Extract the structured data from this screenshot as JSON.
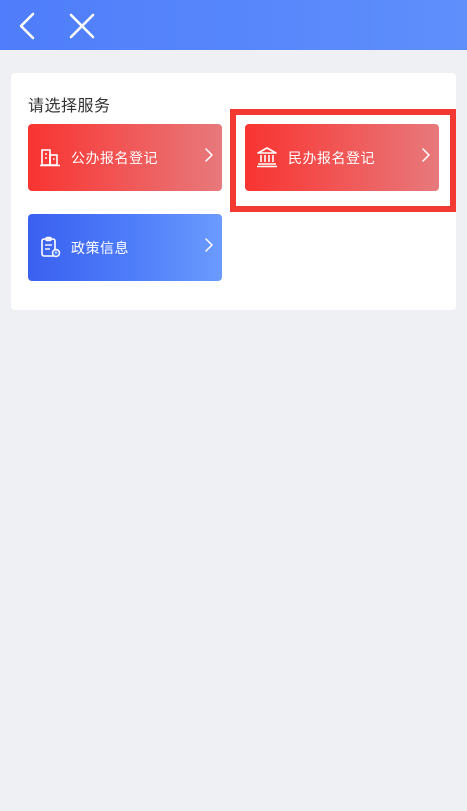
{
  "nav": {
    "back_icon": "chevron-left-icon",
    "close_icon": "close-icon",
    "background": "#5484fb"
  },
  "section": {
    "title": "请选择服务"
  },
  "services": [
    {
      "label": "公办报名登记",
      "icon": "building-icon",
      "color": "#f83431"
    },
    {
      "label": "民办报名登记",
      "icon": "bank-icon",
      "color": "#f83431"
    },
    {
      "label": "政策信息",
      "icon": "clipboard-icon",
      "color": "#3a60f0"
    }
  ],
  "annotation": {
    "highlight_color": "#f23a32"
  }
}
